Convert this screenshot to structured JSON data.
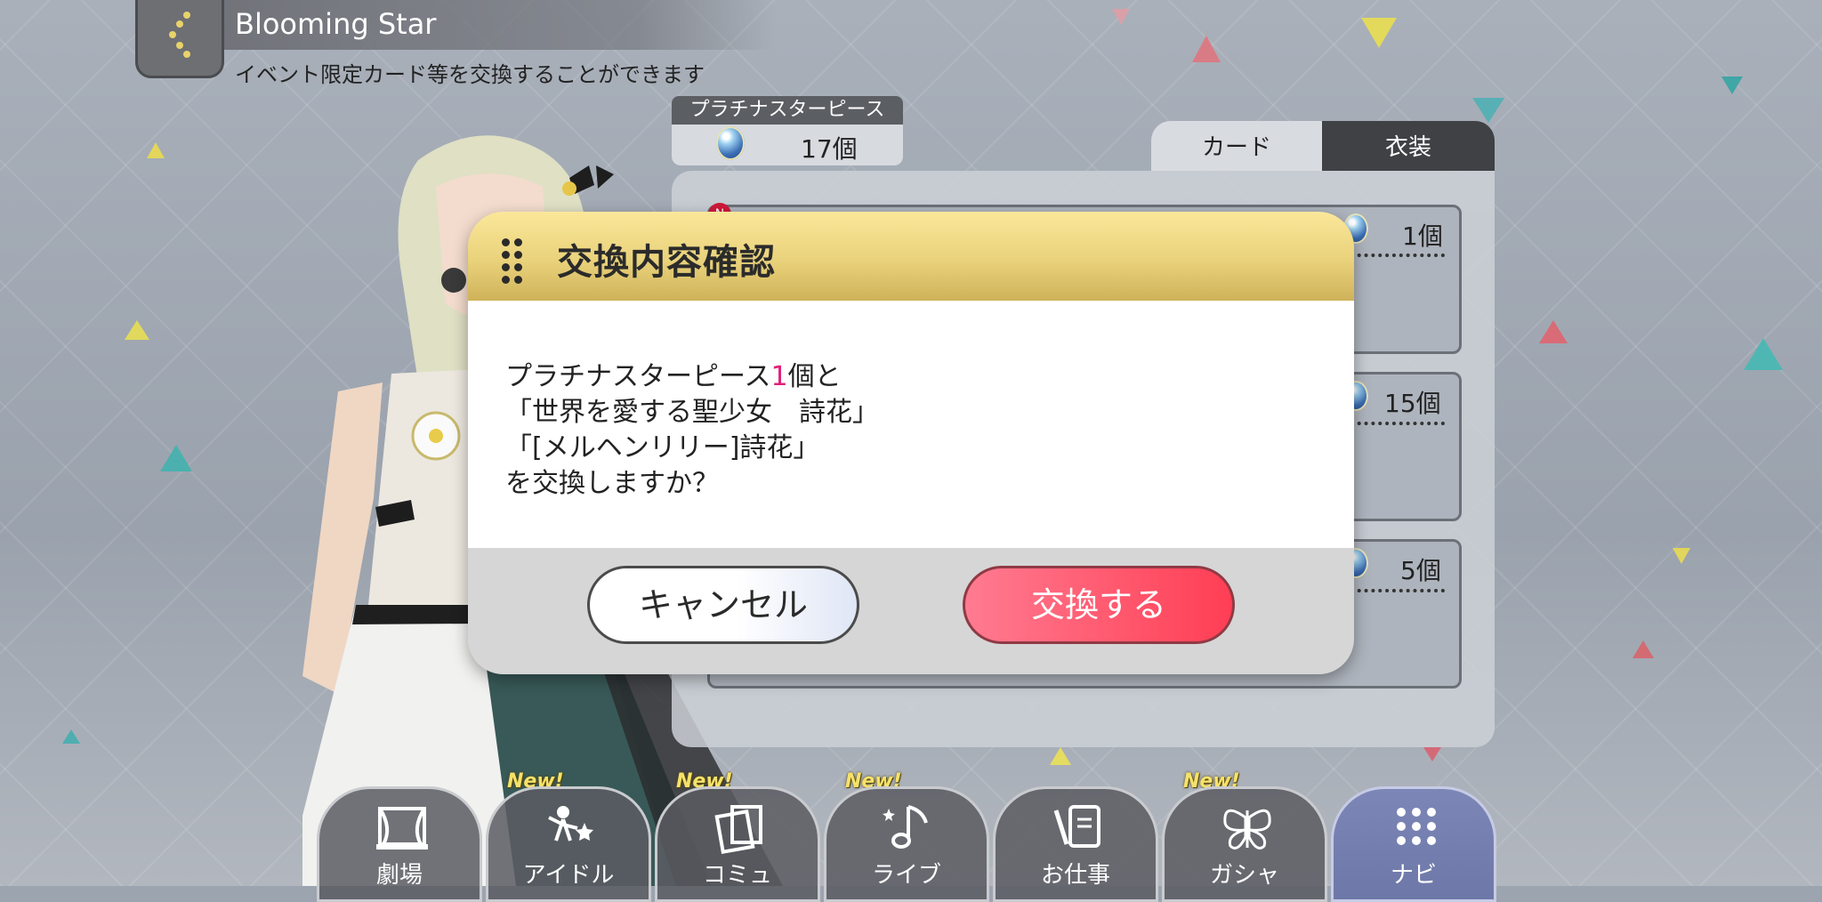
{
  "header": {
    "title": "Blooming Star",
    "subtitle": "イベント限定カード等を交換することができます"
  },
  "currency": {
    "label": "プラチナスターピース",
    "count": "17個"
  },
  "tabs": [
    {
      "label": "カード",
      "active": true
    },
    {
      "label": "衣装",
      "active": false
    }
  ],
  "list_rows": [
    {
      "badge": "N",
      "count": "1個"
    },
    {
      "count": "15個"
    },
    {
      "count": "5個"
    }
  ],
  "dialog": {
    "title": "交換内容確認",
    "line1_prefix": "プラチナスターピース",
    "line1_qty": "1",
    "line1_suffix": "個と",
    "line2": "「世界を愛する聖少女　詩花」",
    "line3": "「[メルヘンリリー]詩花」",
    "line4": "を交換しますか？",
    "cancel_label": "キャンセル",
    "confirm_label": "交換する",
    "highlight_color": "#e0207a"
  },
  "nav": [
    {
      "label": "劇場",
      "icon": "theater-icon",
      "new": false
    },
    {
      "label": "アイドル",
      "icon": "idol-icon",
      "new": true
    },
    {
      "label": "コミュ",
      "icon": "commu-icon",
      "new": true
    },
    {
      "label": "ライブ",
      "icon": "live-icon",
      "new": true
    },
    {
      "label": "お仕事",
      "icon": "work-icon",
      "new": false
    },
    {
      "label": "ガシャ",
      "icon": "gacha-icon",
      "new": true
    },
    {
      "label": "ナビ",
      "icon": "navi-icon",
      "new": false,
      "active": true
    }
  ],
  "new_label": "New!"
}
